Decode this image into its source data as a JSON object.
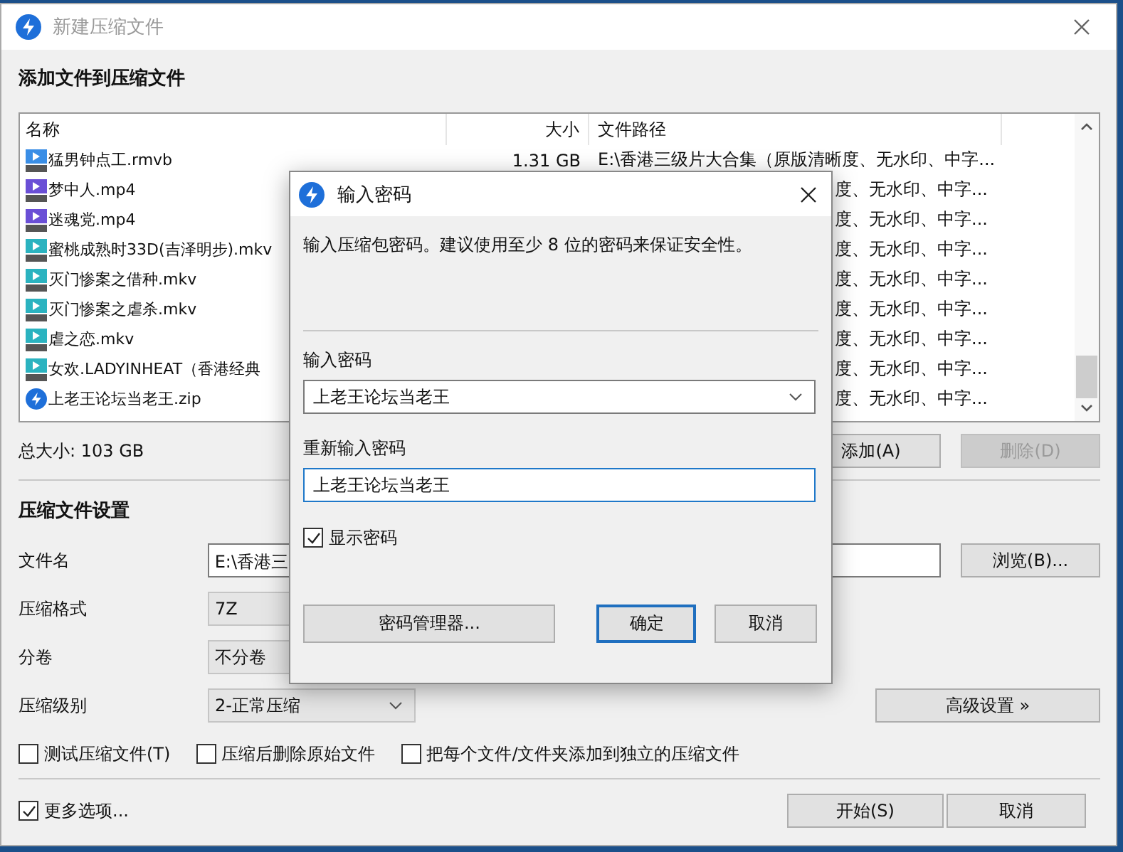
{
  "window": {
    "title": "新建压缩文件"
  },
  "files": {
    "heading": "添加文件到压缩文件",
    "columns": [
      "名称",
      "大小",
      "文件路径"
    ],
    "rows": [
      {
        "kind": "rmvb",
        "name": "猛男钟点工.rmvb",
        "size": "1.31 GB",
        "path": "E:\\香港三级片大合集（原版清晰度、无水印、中字..."
      },
      {
        "kind": "mp4",
        "name": "梦中人.mp4",
        "path": "度、无水印、中字..."
      },
      {
        "kind": "mp4",
        "name": "迷魂党.mp4",
        "path": "度、无水印、中字..."
      },
      {
        "kind": "mkv",
        "name": "蜜桃成熟时33D(吉泽明步).mkv",
        "path": "度、无水印、中字..."
      },
      {
        "kind": "mkv",
        "name": "灭门惨案之借种.mkv",
        "path": "度、无水印、中字..."
      },
      {
        "kind": "mkv",
        "name": "灭门惨案之虐杀.mkv",
        "path": "度、无水印、中字..."
      },
      {
        "kind": "mkv",
        "name": "虐之恋.mkv",
        "path": "度、无水印、中字..."
      },
      {
        "kind": "mkv",
        "name": "女欢.LADYINHEAT（香港经典",
        "path": "度、无水印、中字..."
      },
      {
        "kind": "zip",
        "name": "上老王论坛当老王.zip",
        "path": "度、无水印、中字..."
      }
    ],
    "total_size": "总大小: 103 GB",
    "buttons": [
      {
        "label": "添加(A)",
        "disabled": false
      },
      {
        "label": "删除(D)",
        "disabled": true
      }
    ]
  },
  "settings": {
    "heading": "压缩文件设置",
    "fields": [
      {
        "kind": "text",
        "label": "文件名",
        "value": "E:\\香港三"
      },
      {
        "kind": "select",
        "label": "压缩格式",
        "value": "7Z"
      },
      {
        "kind": "select",
        "label": "分卷",
        "value": "不分卷"
      },
      {
        "kind": "dropdown",
        "label": "压缩级别",
        "value": "2-正常压缩"
      }
    ],
    "browse_button": "浏览(B)...",
    "advanced_button": "高级设置 »",
    "options": [
      {
        "label": "测试压缩文件(T)",
        "checked": false
      },
      {
        "label": "压缩后删除原始文件",
        "checked": false
      },
      {
        "label": "把每个文件/文件夹添加到独立的压缩文件",
        "checked": false
      }
    ]
  },
  "more_options": {
    "label": "更多选项...",
    "checked": true
  },
  "footer_buttons": [
    {
      "label": "开始(S)"
    },
    {
      "label": "取消"
    }
  ],
  "dialog": {
    "title": "输入密码",
    "hint": "输入压缩包密码。建议使用至少 8 位的密码来保证安全性。",
    "password_label": "输入密码",
    "password": "上老王论坛当老王",
    "confirm_label": "重新输入密码",
    "confirm": "上老王论坛当老王",
    "show_password": {
      "label": "显示密码",
      "checked": true
    },
    "buttons": [
      {
        "label": "密码管理器...",
        "default": false
      },
      {
        "label": "确定",
        "default": true
      },
      {
        "label": "取消",
        "default": false
      }
    ]
  }
}
